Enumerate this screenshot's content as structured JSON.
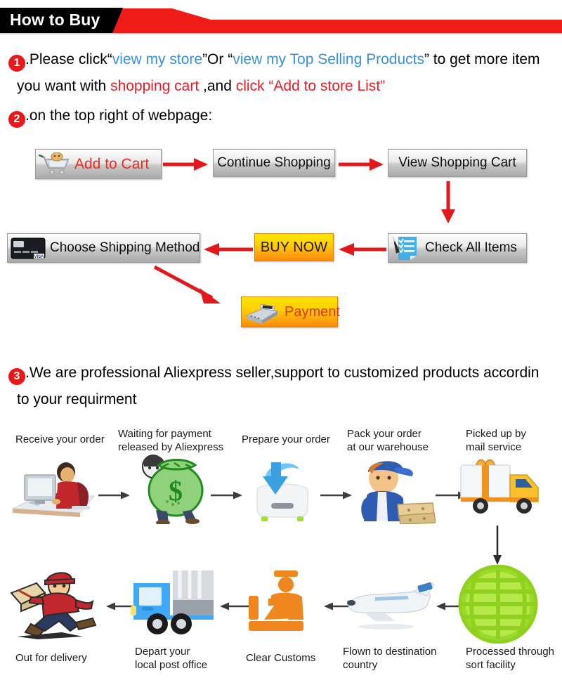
{
  "header": {
    "title": "How to Buy"
  },
  "section1": {
    "number": "1",
    "line1": {
      "t1": ".Please click“",
      "link1": "view my store",
      "t2": "”Or “",
      "link2": "view my Top Selling Products",
      "t3": "” to get more item"
    },
    "line2": {
      "t1": "you want with ",
      "red1": "shopping cart",
      "t2": " ,and ",
      "red2": "click “Add to store List”"
    }
  },
  "section2": {
    "number": "2",
    "text": ".on the top right of webpage:"
  },
  "section3": {
    "number": "3",
    "line1": ".We are professional Aliexpress seller,support to customized products accordin",
    "line2": "to your requirment"
  },
  "buy_flow": {
    "buttons": [
      {
        "id": "add-cart",
        "label": "Add to Cart",
        "icon": "shopping-cart-icon"
      },
      {
        "id": "continue",
        "label": "Continue Shopping",
        "icon": "none"
      },
      {
        "id": "view-cart",
        "label": "View Shopping Cart",
        "icon": "none"
      },
      {
        "id": "choose-shipping",
        "label": "Choose Shipping Method",
        "icon": "credit-card-icon"
      },
      {
        "id": "buy-now",
        "label": "BUY NOW",
        "icon": "none"
      },
      {
        "id": "check-items",
        "label": "Check All Items",
        "icon": "checklist-icon"
      },
      {
        "id": "payment",
        "label": "Payment",
        "icon": "cash-register-icon"
      }
    ],
    "arrow_color": "#e1191c"
  },
  "process": {
    "arrow_color": "#3c3c3c",
    "steps_top": [
      {
        "label": "Receive your order",
        "icon": "person-at-computer-icon"
      },
      {
        "label": "Waiting for payment\nreleased by Aliexpress",
        "icon": "money-bag-icon"
      },
      {
        "label": "Prepare your order",
        "icon": "download-box-icon"
      },
      {
        "label": "Pack your order\nat our warehouse",
        "icon": "warehouse-worker-icon"
      },
      {
        "label": "Picked up by\nmail service",
        "icon": "mail-truck-icon"
      }
    ],
    "steps_bottom": [
      {
        "label": "Out for delivery",
        "icon": "running-courier-icon"
      },
      {
        "label": "Depart your\nlocal post office",
        "icon": "post-truck-icon"
      },
      {
        "label": "Clear Customs",
        "icon": "customs-officer-icon"
      },
      {
        "label": "Flown to destination\ncountry",
        "icon": "airplane-icon"
      },
      {
        "label": "Processed through\nsort facility",
        "icon": "globe-grid-icon"
      }
    ]
  }
}
